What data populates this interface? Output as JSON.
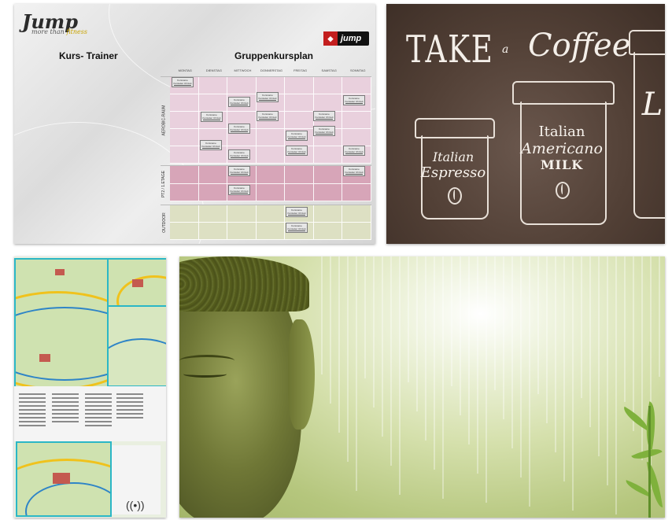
{
  "schedule": {
    "logo": {
      "brand": "Jump",
      "slogan_prefix": "more than",
      "slogan_suffix": "fitness"
    },
    "badge": {
      "label": "jump"
    },
    "left_title": "Kurs- Trainer",
    "right_title": "Gruppenkursplan",
    "days": [
      "MONTAG",
      "DIENSTAG",
      "MITTWOCH",
      "DONNERSTAG",
      "FREITAG",
      "SAMSTAG",
      "SONNTAG"
    ],
    "sections": [
      "AEROBIC-RAUM",
      "PT2 / 1.ETAGE",
      "OUTDOOR"
    ],
    "class_placeholder": "Kursname Kursleiter Uhrzeit",
    "colors": {
      "aerobic": "#e9d0dd",
      "pt": "#d7a5b8",
      "outdoor": "#dde0c3"
    }
  },
  "coffee": {
    "headline_take": "TAKE",
    "headline_a": "a",
    "headline_coffee": "Coffee",
    "cups": [
      {
        "line1": "Italian",
        "line2": "Espresso"
      },
      {
        "line1": "Italian",
        "line2": "Americano",
        "line3": "MILK"
      },
      {
        "line1": "L"
      }
    ],
    "colors": {
      "background": "#524036",
      "chalk": "#f4efe9"
    }
  },
  "map": {
    "colors": {
      "frame": "#2bb7c6",
      "road": "#f0c21c",
      "river": "#2e84c7",
      "land": "#cfe2b0"
    }
  },
  "buddha": {
    "colors": {
      "light": "#eef3dd",
      "mid": "#d5e0ac",
      "shadow": "#454c1f"
    }
  }
}
